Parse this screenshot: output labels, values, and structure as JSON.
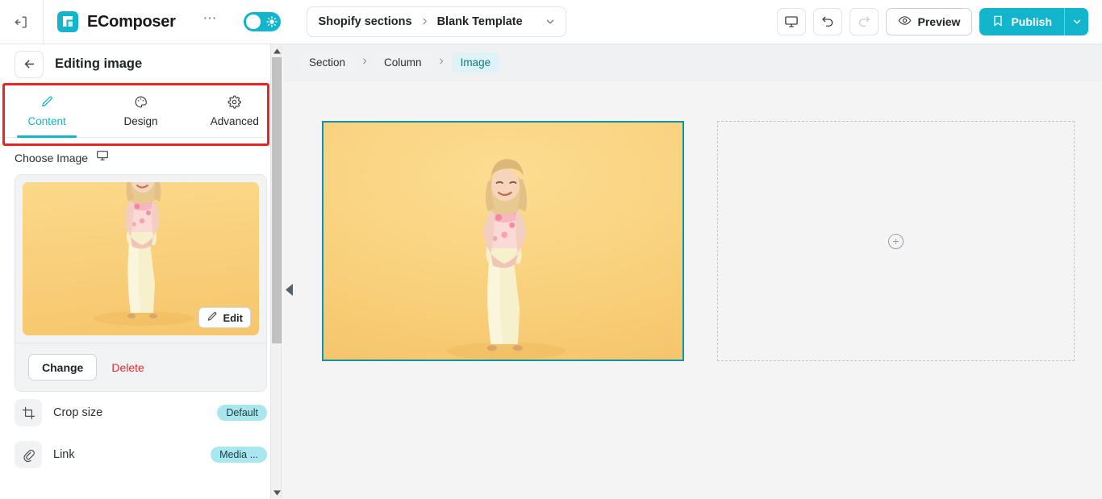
{
  "topbar": {
    "exit_icon": "exit-icon",
    "brand": "EComposer",
    "more_icon": "more-horizontal-icon",
    "theme_toggle": {
      "icon": "sun-icon",
      "state": "on"
    },
    "breadcrumb_select": {
      "root": "Shopify sections",
      "separator": "›",
      "current": "Blank Template",
      "caret_icon": "chevron-down-icon"
    },
    "actions": {
      "device_icon": "desktop-icon",
      "undo_icon": "undo-icon",
      "redo_icon": "redo-icon",
      "preview_label": "Preview",
      "preview_icon": "eye-icon",
      "publish_label": "Publish",
      "publish_icon": "bookmark-icon",
      "publish_caret_icon": "chevron-down-icon"
    }
  },
  "sidebar": {
    "back_icon": "arrow-left-icon",
    "title": "Editing image",
    "tabs": [
      {
        "label": "Content",
        "icon": "pencil-icon",
        "active": true
      },
      {
        "label": "Design",
        "icon": "palette-icon",
        "active": false
      },
      {
        "label": "Advanced",
        "icon": "gear-icon",
        "active": false
      }
    ],
    "choose_image": {
      "label": "Choose Image",
      "device_icon": "desktop-icon",
      "edit_label": "Edit",
      "edit_icon": "pencil-icon",
      "change_label": "Change",
      "delete_label": "Delete"
    },
    "settings": [
      {
        "label": "Crop size",
        "icon": "crop-icon",
        "badge": "Default"
      },
      {
        "label": "Link",
        "icon": "link-icon",
        "badge": "Media ..."
      }
    ],
    "scrollbar": {
      "up_icon": "caret-up-icon",
      "down_icon": "caret-down-icon"
    }
  },
  "main": {
    "breadcrumb": [
      {
        "label": "Section",
        "active": false
      },
      {
        "label": "Column",
        "active": false
      },
      {
        "label": "Image",
        "active": true
      }
    ],
    "breadcrumb_separator": "›",
    "canvas": {
      "selected_element": "Image",
      "empty_column_icon": "plus-circle-icon",
      "collapse_handle_icon": "caret-left-icon"
    }
  },
  "colors": {
    "accent": "#12b5cb",
    "selection": "#0f93a8",
    "highlight": "#ee2222",
    "danger": "#e02b2b",
    "badge_bg": "#a9e7ef",
    "canvas_bg": "#f4f4f5"
  }
}
